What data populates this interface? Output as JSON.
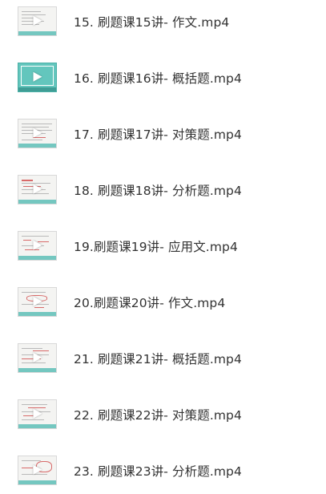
{
  "files": [
    {
      "name": "15. 刷题课15讲- 作文.mp4",
      "thumb_style": "light"
    },
    {
      "name": "16. 刷题课16讲- 概括题.mp4",
      "thumb_style": "teal"
    },
    {
      "name": "17. 刷题课17讲- 对策题.mp4",
      "thumb_style": "light"
    },
    {
      "name": "18. 刷题课18讲- 分析题.mp4",
      "thumb_style": "light"
    },
    {
      "name": "19.刷题课19讲- 应用文.mp4",
      "thumb_style": "light"
    },
    {
      "name": "20.刷题课20讲- 作文.mp4",
      "thumb_style": "light"
    },
    {
      "name": "21. 刷题课21讲- 概括题.mp4",
      "thumb_style": "light"
    },
    {
      "name": "22. 刷题课22讲- 对策题.mp4",
      "thumb_style": "light"
    },
    {
      "name": "23. 刷题课23讲- 分析题.mp4",
      "thumb_style": "light"
    }
  ],
  "icon": "play-icon",
  "colors": {
    "text": "#333333",
    "thumb_bar": "#74c7c0",
    "thumb_teal": "#63c6bd",
    "annotation_red": "#d86a6a"
  }
}
